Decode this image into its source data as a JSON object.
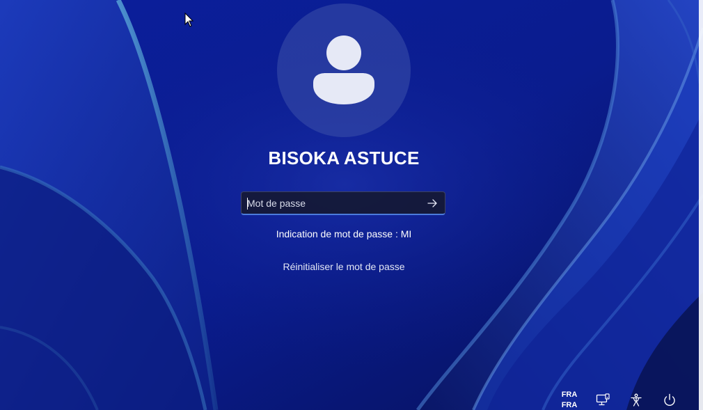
{
  "login": {
    "user_name": "BISOKA ASTUCE",
    "password_placeholder": "Mot de passe",
    "password_hint": "Indication de mot de passe : MI",
    "reset_link": "Réinitialiser le mot de passe"
  },
  "tray": {
    "language_line1": "FRA",
    "language_line2": "FRA",
    "icons": [
      "network-icon",
      "accessibility-icon",
      "power-icon"
    ]
  },
  "colors": {
    "background": "#0a1a8a",
    "input_accent": "#4b7bdc"
  }
}
